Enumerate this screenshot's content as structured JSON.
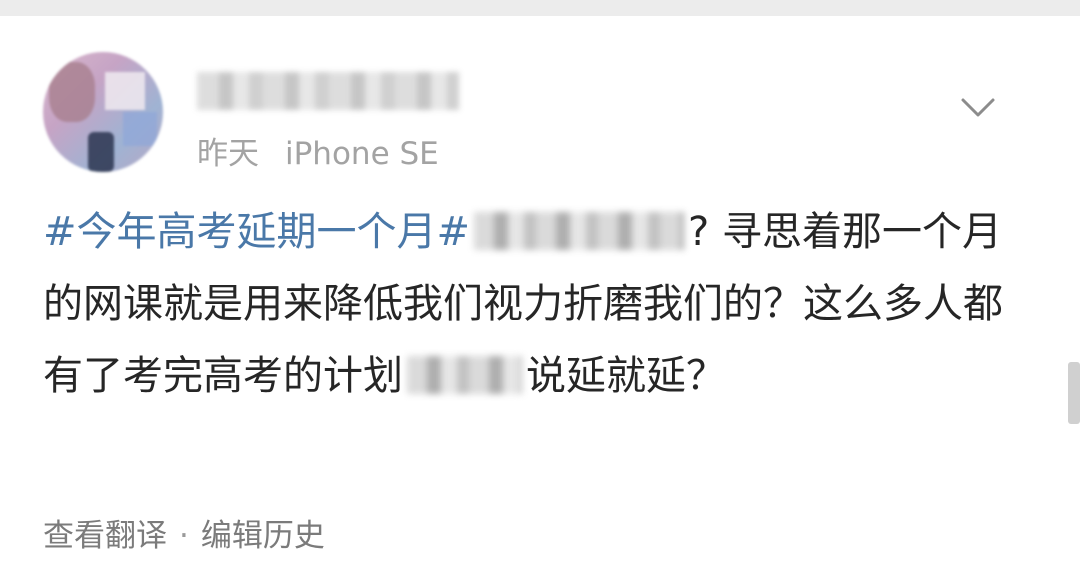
{
  "post": {
    "author": {
      "avatar_icon": "user-avatar-icon",
      "name": ""
    },
    "meta": {
      "time": "昨天",
      "device": "iPhone SE"
    },
    "menu_icon": "chevron-down-icon",
    "content": {
      "hashtag": "#今年高考延期一个月#",
      "text_1": "? 寻思着那一个月的网课就是用来降低我们视力折磨我们的？这么多人都有了考完高考的计划",
      "text_2": "说延就延？"
    },
    "footer": {
      "translate": "查看翻译",
      "separator": "·",
      "edit_history": "编辑历史"
    }
  },
  "colors": {
    "hashtag": "#4a78a8",
    "body_text": "#262626",
    "meta_text": "#a3a3a3"
  }
}
